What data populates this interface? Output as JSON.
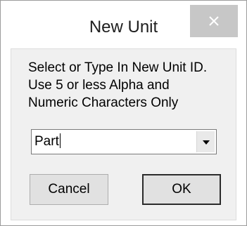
{
  "window": {
    "title": "New Unit",
    "close_icon": "close-icon"
  },
  "dialog": {
    "instruction_lines": [
      "Select or Type In New Unit ID.",
      "Use 5 or less Alpha and",
      "Numeric Characters Only"
    ],
    "unit_id_value": "Part",
    "dropdown_icon": "dropdown-arrow-icon",
    "cancel_label": "Cancel",
    "ok_label": "OK"
  },
  "colors": {
    "client_background": "#f0f0f0",
    "button_background": "#e1e1e1",
    "close_button_background": "#c7c7c7"
  }
}
